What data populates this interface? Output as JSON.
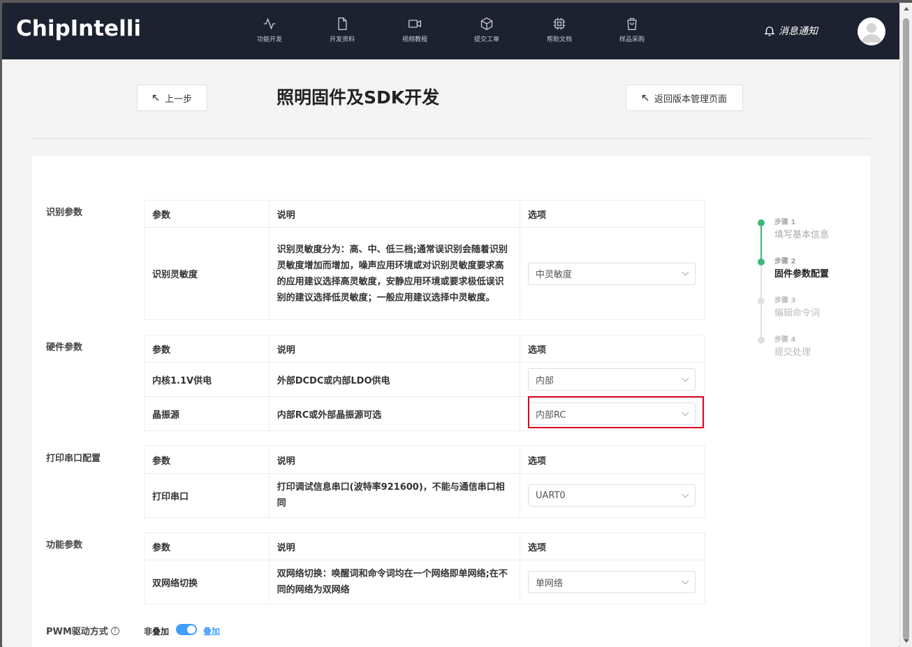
{
  "header": {
    "logo": "ChipIntelli",
    "nav": [
      {
        "label": "功能开发",
        "icon": "activity-icon"
      },
      {
        "label": "开发资料",
        "icon": "file-icon"
      },
      {
        "label": "视频教程",
        "icon": "video-icon"
      },
      {
        "label": "提交工单",
        "icon": "box-icon"
      },
      {
        "label": "帮助文档",
        "icon": "chip-icon"
      },
      {
        "label": "样品采购",
        "icon": "shopping-bag-icon"
      }
    ],
    "notify_label": "消息通知"
  },
  "title_bar": {
    "back_label": "上一步",
    "title": "照明固件及SDK开发",
    "return_label": "返回版本管理页面"
  },
  "sections": [
    {
      "label": "识别参数",
      "headers": [
        "参数",
        "说明",
        "选项"
      ],
      "rows": [
        {
          "param": "识别灵敏度",
          "desc": "识别灵敏度分为：高、中、低三档;通常误识别会随着识别灵敏度增加而增加，噪声应用环境或对识别灵敏度要求高的应用建议选择高灵敏度，安静应用环境或要求极低误识别的建议选择低灵敏度；一般应用建议选择中灵敏度。",
          "value": "中灵敏度"
        }
      ]
    },
    {
      "label": "硬件参数",
      "headers": [
        "参数",
        "说明",
        "选项"
      ],
      "rows": [
        {
          "param": "内核1.1V供电",
          "desc": "外部DCDC或内部LDO供电",
          "value": "内部"
        },
        {
          "param": "晶振源",
          "desc": "内部RC或外部晶振源可选",
          "value": "内部RC"
        }
      ]
    },
    {
      "label": "打印串口配置",
      "headers": [
        "参数",
        "说明",
        "选项"
      ],
      "rows": [
        {
          "param": "打印串口",
          "desc": "打印调试信息串口(波特率921600)，不能与通信串口相同",
          "value": "UART0"
        }
      ]
    },
    {
      "label": "功能参数",
      "headers": [
        "参数",
        "说明",
        "选项"
      ],
      "rows": [
        {
          "param": "双网络切换",
          "desc": "双网络切换：唤醒词和命令词均在一个网络即单网络;在不同的网络为双网络",
          "value": "单网络"
        }
      ]
    }
  ],
  "pwm": {
    "label": "PWM驱动方式",
    "off_label": "非叠加",
    "on_label": "叠加",
    "enabled": true
  },
  "steps": [
    {
      "num": "步骤 1",
      "label": "填写基本信息",
      "state": "done"
    },
    {
      "num": "步骤 2",
      "label": "固件参数配置",
      "state": "active"
    },
    {
      "num": "步骤 3",
      "label": "编辑命令词",
      "state": "pending"
    },
    {
      "num": "步骤 4",
      "label": "提交处理",
      "state": "pending"
    }
  ],
  "colors": {
    "header_bg": "#1d2230",
    "accent_green": "#3bb87a",
    "accent_blue": "#409eff",
    "highlight_red": "#d9001b"
  }
}
